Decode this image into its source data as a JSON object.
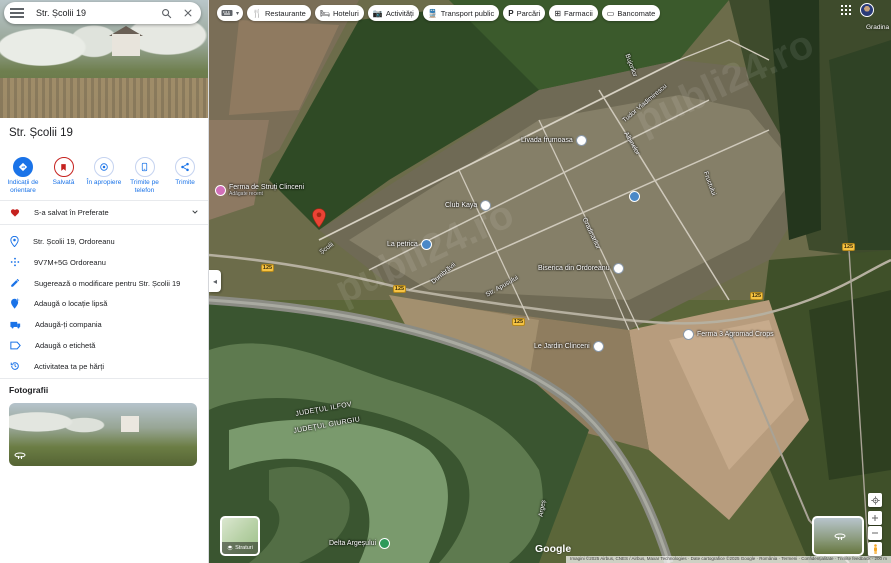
{
  "search": {
    "query": "Str. Școlii 19"
  },
  "place": {
    "title": "Str. Școlii 19"
  },
  "actions": [
    {
      "label": "Indicații de orientare"
    },
    {
      "label": "Salvată"
    },
    {
      "label": "În apropiere"
    },
    {
      "label": "Trimite pe telefon"
    },
    {
      "label": "Trimite"
    }
  ],
  "saved": {
    "label": "S-a salvat în Preferate"
  },
  "info_rows": [
    {
      "icon": "location-pin-icon",
      "label": "Str. Școlii 19, Ordoreanu"
    },
    {
      "icon": "plus-code-icon",
      "label": "9V7M+5G Ordoreanu"
    },
    {
      "icon": "edit-pencil-icon",
      "label": "Sugerează o modificare pentru Str. Școlii 19"
    },
    {
      "icon": "add-location-icon",
      "label": "Adaugă o locație lipsă"
    },
    {
      "icon": "business-icon",
      "label": "Adaugă-ți compania"
    },
    {
      "icon": "label-icon",
      "label": "Adaugă o etichetă"
    },
    {
      "icon": "history-icon",
      "label": "Activitatea ta pe hărți"
    }
  ],
  "photos": {
    "title": "Fotografii"
  },
  "chips": [
    {
      "icon": "restaurant-icon",
      "label": "Restaurante"
    },
    {
      "icon": "hotel-icon",
      "label": "Hoteluri"
    },
    {
      "icon": "camera-icon",
      "label": "Activități"
    },
    {
      "icon": "transit-icon",
      "label": "Transport public"
    },
    {
      "icon": "parking-icon",
      "label": "Parcări"
    },
    {
      "icon": "pharmacy-icon",
      "label": "Farmacii"
    },
    {
      "icon": "atm-icon",
      "label": "Bancomate"
    }
  ],
  "map": {
    "pois": [
      {
        "name": "Livada frumoasa",
        "sub": ""
      },
      {
        "name": "Ferma de Struți Clinceni",
        "sub": "Adăgate recent"
      },
      {
        "name": "Club Kaya",
        "sub": ""
      },
      {
        "name": "La petrica",
        "sub": ""
      },
      {
        "name": "Biserica din Ordoreanu",
        "sub": ""
      },
      {
        "name": "Ferma 3 Agromad Crops",
        "sub": ""
      },
      {
        "name": "Le Jardin Clinceni",
        "sub": ""
      },
      {
        "name": "Delta Argeșului",
        "sub": ""
      }
    ],
    "streets": [
      "Tudor Vladimirescu",
      "Bujorilor",
      "Albinelor",
      "Școlii",
      "Dumbrăvii",
      "Str. Apusului",
      "Gradinarilor",
      "Fructului",
      "Argeș"
    ],
    "road_numbers": [
      "125",
      "125",
      "125",
      "125",
      "125"
    ],
    "regions": [
      "JUDEȚUL ILFOV",
      "JUDEȚUL GIURGIU"
    ],
    "corner_label": "Gradina",
    "layers_label": "Straturi",
    "brand": "Google",
    "attribution": "Imagini ©2025 Airbus, CNES / Airbus, Maxar Technologies · Date cartografice ©2025 Google · România · Termeni · Confidențialitate · Trimite feedback · 200 m"
  },
  "watermark": "publi24.ro",
  "colors": {
    "accent": "#1a73e8",
    "saved_heart": "#c5221f",
    "pin": "#ea4335"
  }
}
